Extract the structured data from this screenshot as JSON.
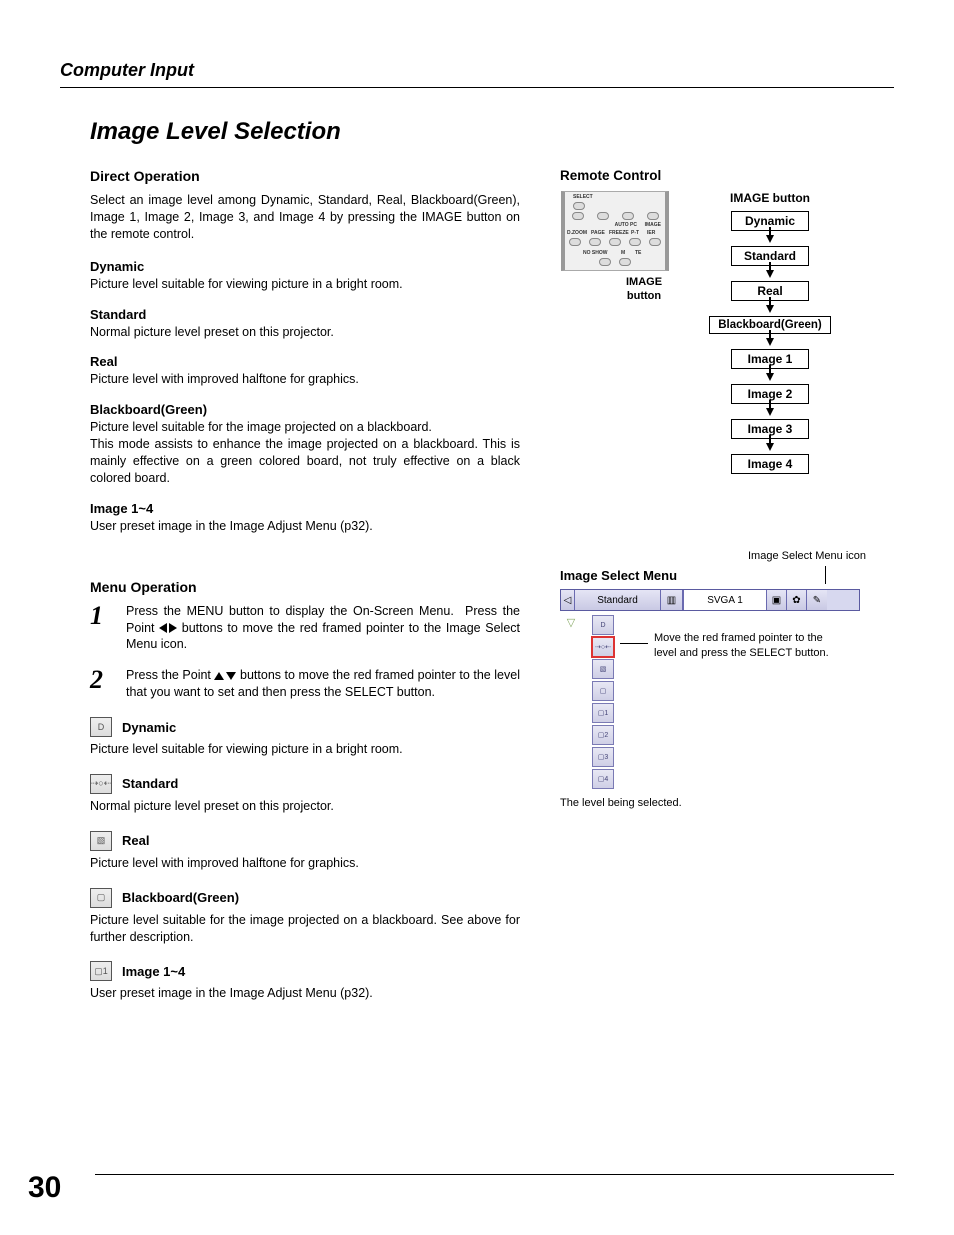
{
  "header": {
    "section": "Computer Input"
  },
  "title": "Image Level Selection",
  "direct": {
    "heading": "Direct Operation",
    "intro": "Select an image level among Dynamic, Standard, Real, Blackboard(Green), Image 1, Image 2, Image 3, and Image 4 by pressing the IMAGE button on the remote control.",
    "items": [
      {
        "name": "Dynamic",
        "desc": "Picture level suitable for viewing picture in a bright room."
      },
      {
        "name": "Standard",
        "desc": "Normal picture level preset on this projector."
      },
      {
        "name": "Real",
        "desc": "Picture level with improved halftone for graphics."
      },
      {
        "name": "Blackboard(Green)",
        "desc": "Picture level suitable for the image projected on a blackboard.\nThis mode assists to enhance the image projected on a blackboard.  This is mainly effective on a green colored board, not truly effective on a black colored board."
      },
      {
        "name": "Image 1~4",
        "desc": "User preset image in the Image Adjust Menu (p32)."
      }
    ]
  },
  "menu": {
    "heading": "Menu Operation",
    "steps": [
      {
        "num": "1",
        "text": "Press the MENU button to display the On-Screen Menu.  Press the Point ◀▶ buttons to move the red framed pointer to the Image Select Menu icon."
      },
      {
        "num": "2",
        "text": "Press the Point ▲▼ buttons to move the red framed pointer to the level that you want to set and then press the SELECT button."
      }
    ],
    "iconItems": [
      {
        "name": "Dynamic",
        "desc": "Picture level suitable for viewing picture in a bright room.",
        "glyph": "D"
      },
      {
        "name": "Standard",
        "desc": "Normal picture level preset on this projector.",
        "glyph": "⇢○⇠"
      },
      {
        "name": "Real",
        "desc": "Picture level with improved halftone for graphics.",
        "glyph": "▧"
      },
      {
        "name": "Blackboard(Green)",
        "desc": "Picture level suitable for the image projected on a blackboard.   See above for further description.",
        "glyph": "▢"
      },
      {
        "name": "Image 1~4",
        "desc": "User preset image in the Image Adjust Menu (p32).",
        "glyph": "▢1"
      }
    ]
  },
  "remote": {
    "heading": "Remote Control",
    "labelTop": "SELECT",
    "row2": [
      "AUTO PC",
      "IMAGE"
    ],
    "row3": [
      "D.ZOOM",
      "PAGE",
      "FREEZE",
      "P-T",
      "IER"
    ],
    "row4": [
      "NO SHOW",
      "M",
      "TE"
    ],
    "under": "IMAGE button"
  },
  "flow": {
    "title": "IMAGE button",
    "items": [
      "Dynamic",
      "Standard",
      "Real",
      "Blackboard(Green)",
      "Image 1",
      "Image 2",
      "Image 3",
      "Image 4"
    ]
  },
  "ism": {
    "pointerLabel": "Image Select Menu icon",
    "heading": "Image Select Menu",
    "bar": {
      "current": "Standard",
      "signal": "SVGA 1"
    },
    "sideIcons": [
      "D",
      "⇢○⇠",
      "▧",
      "▢",
      "▢1",
      "▢2",
      "▢3",
      "▢4"
    ],
    "note": "Move the red framed pointer to the level and press the SELECT button.",
    "caption": "The level being selected."
  },
  "pageNumber": "30"
}
